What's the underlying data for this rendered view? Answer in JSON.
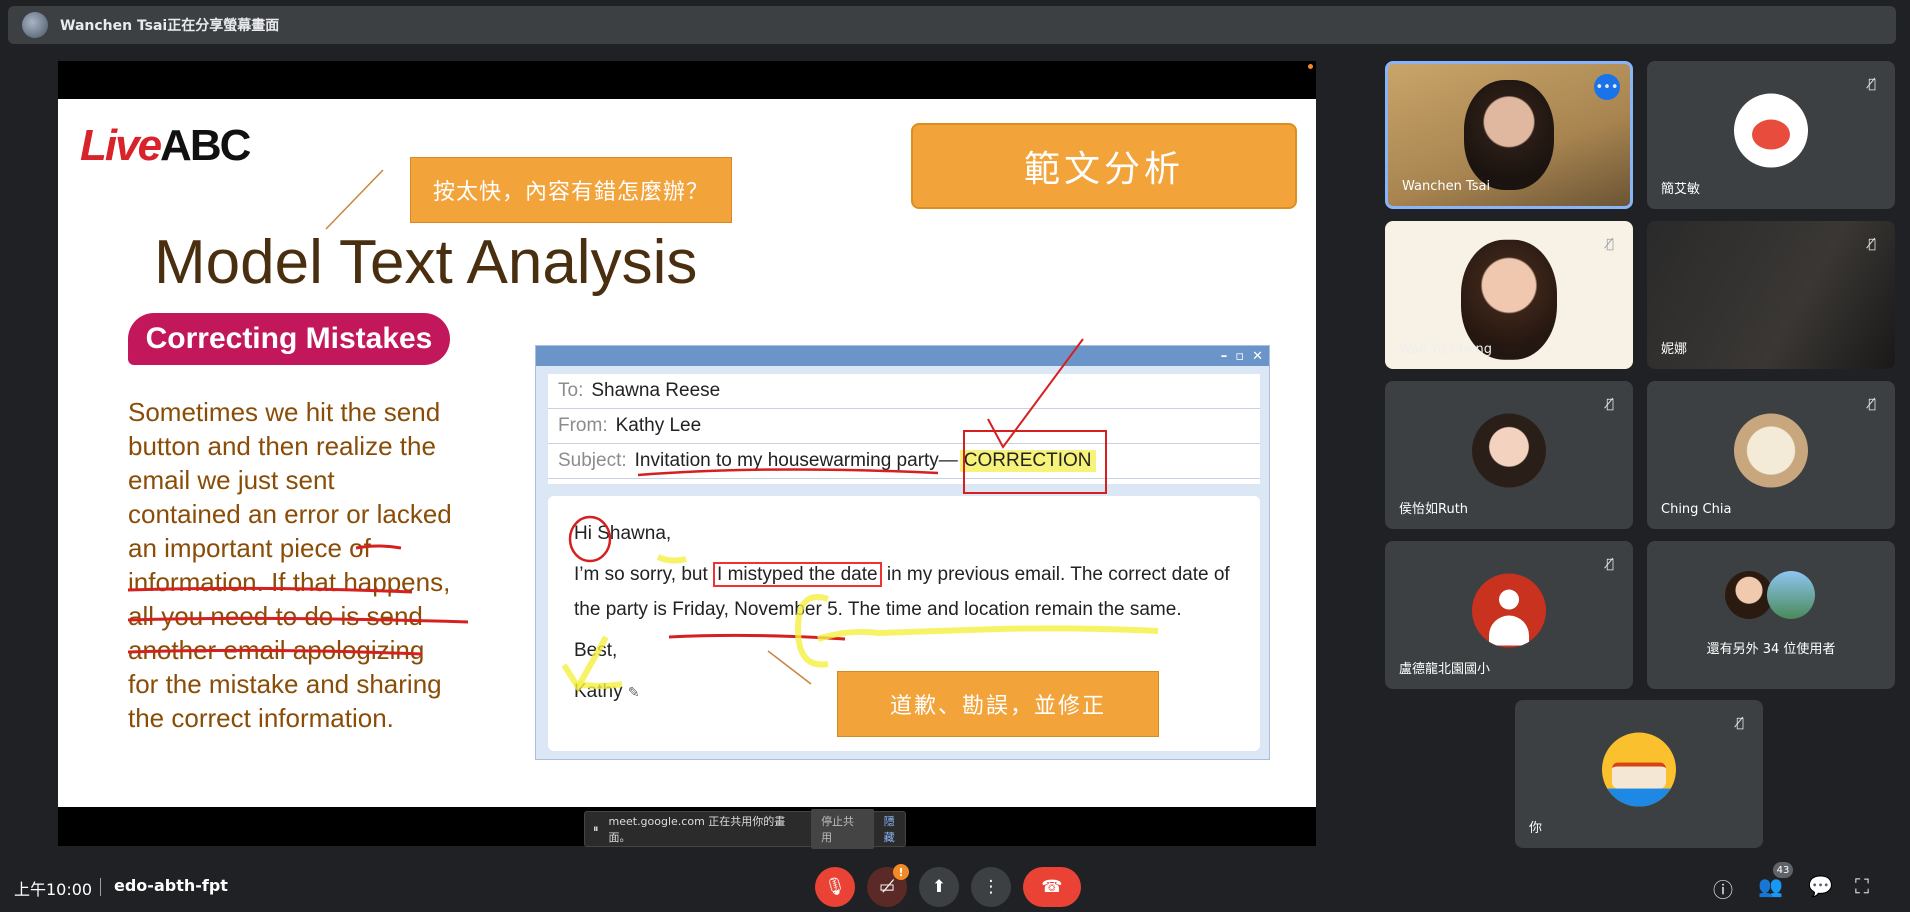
{
  "topbar": {
    "title": "Wanchen Tsai正在分享螢幕畫面"
  },
  "slide": {
    "logo_live": "Live",
    "logo_abc": "ABC",
    "callout_top": "按太快，內容有錯怎麼辦？",
    "header": "範文分析",
    "title": "Model Text Analysis",
    "pill": "Correcting Mistakes",
    "body_lines": [
      "Sometimes we hit the send",
      "button and then realize the",
      "email we just sent",
      "contained an error or lacked",
      "an important piece of",
      "information. If that happens,",
      "all you need to do is send",
      "another email apologizing",
      "for the mistake and sharing",
      "the correct information."
    ],
    "email": {
      "to_label": "To:",
      "to": "Shawna Reese",
      "from_label": "From:",
      "from": "Kathy Lee",
      "subject_label": "Subject:",
      "subject": "Invitation to my housewarming party—",
      "subject_corr": "CORRECTION",
      "greeting": "Hi Shawna,",
      "line1_a": "I’m so sorry, but ",
      "line1_box": "I mistyped the date",
      "line1_b": " in my previous email. The correct date of",
      "line2_a": "the party is ",
      "line2_u": "Friday, November 5",
      "line2_b": ". The time and location remain the same.",
      "closing": "Best,",
      "signature": "Kathy"
    },
    "callout_bottom": "道歉、勘誤，並修正"
  },
  "share_bar": {
    "text": "meet.google.com 正在共用你的畫面。",
    "stop": "停止共用",
    "hide": "隱藏"
  },
  "participants": [
    {
      "name": "Wanchen Tsai"
    },
    {
      "name": "簡艾敏"
    },
    {
      "name": "Wan Yu Cheng"
    },
    {
      "name": "妮娜"
    },
    {
      "name": "侯怡如Ruth"
    },
    {
      "name": "Ching Chia"
    },
    {
      "name": "盧德龍北園國小"
    },
    {
      "name": "還有另外 34 位使用者"
    },
    {
      "name": "你"
    }
  ],
  "bottom": {
    "time": "上午10:00",
    "meeting_code": "edo-abth-fpt",
    "people_count": "43"
  }
}
